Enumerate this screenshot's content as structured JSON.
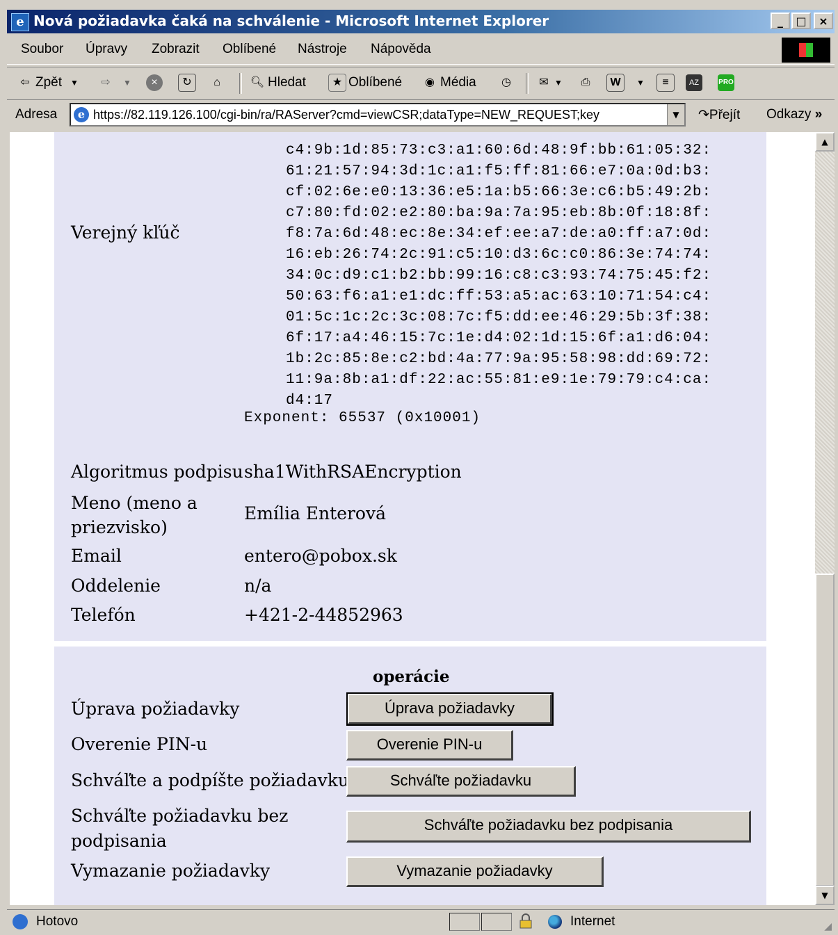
{
  "window": {
    "title": "Nová požiadavka čaká na schválenie - Microsoft Internet Explorer",
    "minimize": "_",
    "maximize": "□",
    "close": "×"
  },
  "menu": [
    "Soubor",
    "Úpravy",
    "Zobrazit",
    "Oblíbené",
    "Nástroje",
    "Nápověda"
  ],
  "toolbar": {
    "back": "Zpět",
    "search": "Hledat",
    "favorites": "Oblíbené",
    "media": "Média"
  },
  "address": {
    "label": "Adresa",
    "url": "https://82.119.126.100/cgi-bin/ra/RAServer?cmd=viewCSR;dataType=NEW_REQUEST;key",
    "go": "Přejít",
    "links": "Odkazy"
  },
  "certificate": {
    "public_key_label": "Verejný kľúč",
    "hex_lines": [
      "c4:9b:1d:85:73:c3:a1:60:6d:48:9f:bb:61:05:32:",
      "61:21:57:94:3d:1c:a1:f5:ff:81:66:e7:0a:0d:b3:",
      "cf:02:6e:e0:13:36:e5:1a:b5:66:3e:c6:b5:49:2b:",
      "c7:80:fd:02:e2:80:ba:9a:7a:95:eb:8b:0f:18:8f:",
      "f8:7a:6d:48:ec:8e:34:ef:ee:a7:de:a0:ff:a7:0d:",
      "16:eb:26:74:2c:91:c5:10:d3:6c:c0:86:3e:74:74:",
      "34:0c:d9:c1:b2:bb:99:16:c8:c3:93:74:75:45:f2:",
      "50:63:f6:a1:e1:dc:ff:53:a5:ac:63:10:71:54:c4:",
      "01:5c:1c:2c:3c:08:7c:f5:dd:ee:46:29:5b:3f:38:",
      "6f:17:a4:46:15:7c:1e:d4:02:1d:15:6f:a1:d6:04:",
      "1b:2c:85:8e:c2:bd:4a:77:9a:95:58:98:dd:69:72:",
      "11:9a:8b:a1:df:22:ac:55:81:e9:1e:79:79:c4:ca:",
      "d4:17"
    ],
    "exponent": "Exponent: 65537 (0x10001)",
    "fields": [
      {
        "label": "Algoritmus podpisu",
        "value": "sha1WithRSAEncryption"
      },
      {
        "label": "Meno (meno a priezvisko)",
        "value": "Emília Enterová"
      },
      {
        "label": "Email",
        "value": "entero@pobox.sk"
      },
      {
        "label": "Oddelenie",
        "value": "n/a"
      },
      {
        "label": "Telefón",
        "value": "+421-2-44852963"
      }
    ]
  },
  "operations": {
    "title": "operácie",
    "rows": [
      {
        "label": "Úprava požiadavky",
        "button": "Úprava požiadavky"
      },
      {
        "label": "Overenie PIN-u",
        "button": "Overenie PIN-u"
      },
      {
        "label": "Schváľte a podpíšte požiadavku",
        "button": "Schváľte požiadavku"
      },
      {
        "label": "Schváľte požiadavku bez podpisania",
        "button": "Schváľte požiadavku bez podpisania"
      },
      {
        "label": "Vymazanie požiadavky",
        "button": "Vymazanie požiadavky"
      }
    ]
  },
  "status": {
    "text": "Hotovo",
    "zone": "Internet"
  }
}
